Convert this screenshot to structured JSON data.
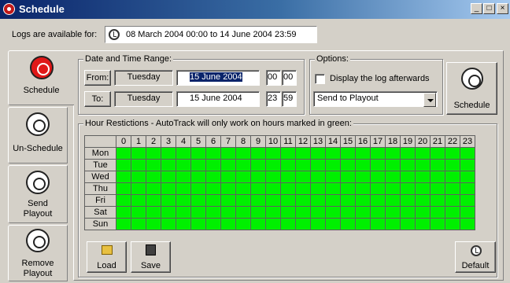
{
  "window": {
    "title": "Schedule",
    "controls": [
      "_",
      "□",
      "×"
    ]
  },
  "logs": {
    "label": "Logs are available for:",
    "range": "08 March 2004 00:00  to  14 June 2004 23:59"
  },
  "side_tabs": [
    {
      "label": "Schedule",
      "icon": "schedule-icon",
      "active": true
    },
    {
      "label": "Un-Schedule",
      "icon": "unschedule-icon",
      "active": false
    },
    {
      "label": "Send Playout",
      "icon": "send-playout-icon",
      "active": false
    },
    {
      "label": "Remove Playout",
      "icon": "remove-playout-icon",
      "active": false
    }
  ],
  "date_range": {
    "title": "Date and Time Range:",
    "from": {
      "button": "From:",
      "weekday": "Tuesday",
      "date": "15 June 2004",
      "hour": "00",
      "minute": "00"
    },
    "to": {
      "button": "To:",
      "weekday": "Tuesday",
      "date": "15 June 2004",
      "hour": "23",
      "minute": "59"
    }
  },
  "options": {
    "title": "Options:",
    "checkbox_label": "Display the log afterwards",
    "checkbox_checked": false,
    "dropdown_value": "Send to Playout"
  },
  "schedule_button": "Schedule",
  "hours": {
    "title": "Hour Restictions - AutoTrack  will only work on hours marked in green:",
    "columns": [
      "0",
      "1",
      "2",
      "3",
      "4",
      "5",
      "6",
      "7",
      "8",
      "9",
      "10",
      "11",
      "12",
      "13",
      "14",
      "15",
      "16",
      "17",
      "18",
      "19",
      "20",
      "21",
      "22",
      "23"
    ],
    "days": [
      "Mon",
      "Tue",
      "Wed",
      "Thu",
      "Fri",
      "Sat",
      "Sun"
    ],
    "all_enabled": true,
    "enabled_color": "#00f000"
  },
  "bottom_buttons": {
    "load": "Load",
    "save": "Save",
    "default": "Default"
  }
}
